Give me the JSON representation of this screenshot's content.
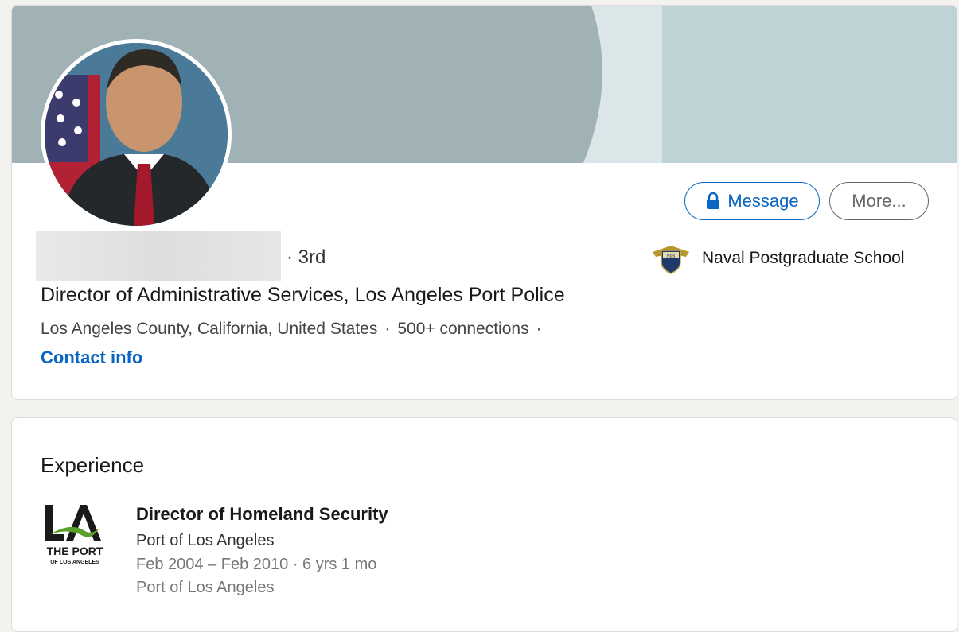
{
  "profile": {
    "degree": "· 3rd",
    "headline": "Director of Administrative Services, Los Angeles Port Police",
    "location": "Los Angeles County, California, United States",
    "connections": "500+ connections",
    "separator": "·",
    "contact_info": "Contact info",
    "education": "Naval Postgraduate School"
  },
  "actions": {
    "message_label": "Message",
    "more_label": "More..."
  },
  "experience": {
    "section_title": "Experience",
    "items": [
      {
        "role": "Director of Homeland Security",
        "company": "Port of Los Angeles",
        "dates": "Feb 2004 – Feb 2010 · 6 yrs 1 mo",
        "location": "Port of Los Angeles",
        "logo_text": "THE PORT",
        "logo_subtext": "OF LOS ANGELES"
      }
    ]
  },
  "colors": {
    "accent": "#0a66c2",
    "cover_dark": "#a0b2b5",
    "cover_light": "#dbe6e8",
    "cover_right": "#bfd3d7"
  }
}
